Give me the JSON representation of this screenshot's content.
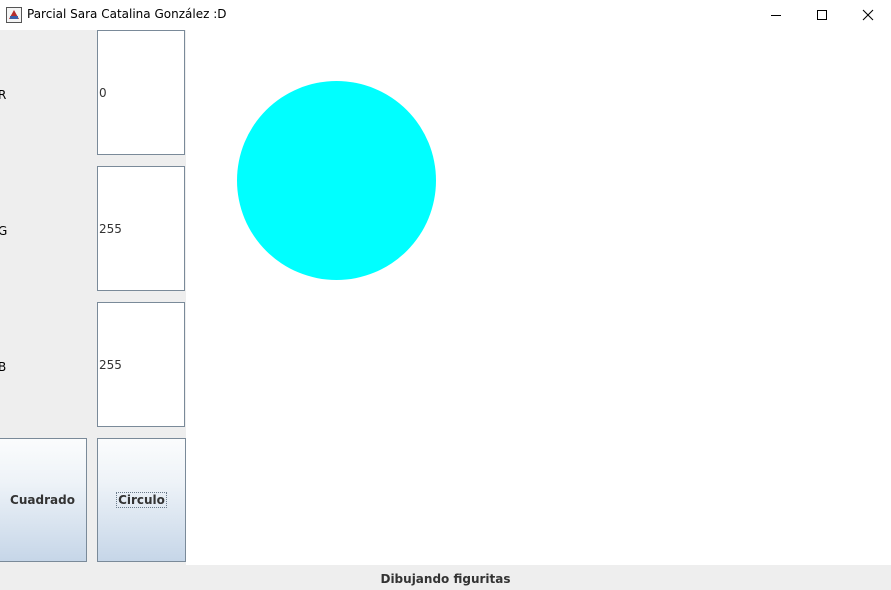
{
  "window": {
    "title": "Parcial Sara Catalina González :D",
    "icon": "java-app-icon",
    "controls": [
      "minimize-icon",
      "maximize-icon",
      "close-icon"
    ]
  },
  "color_inputs": {
    "r": {
      "label": "R",
      "value": "0"
    },
    "g": {
      "label": "G",
      "value": "255"
    },
    "b": {
      "label": "B",
      "value": "255"
    }
  },
  "buttons": {
    "square": "Cuadrado",
    "circle": "Circulo"
  },
  "canvas": {
    "shape": "circle",
    "fill_color": "#00ffff"
  },
  "status": "Dibujando figuritas"
}
